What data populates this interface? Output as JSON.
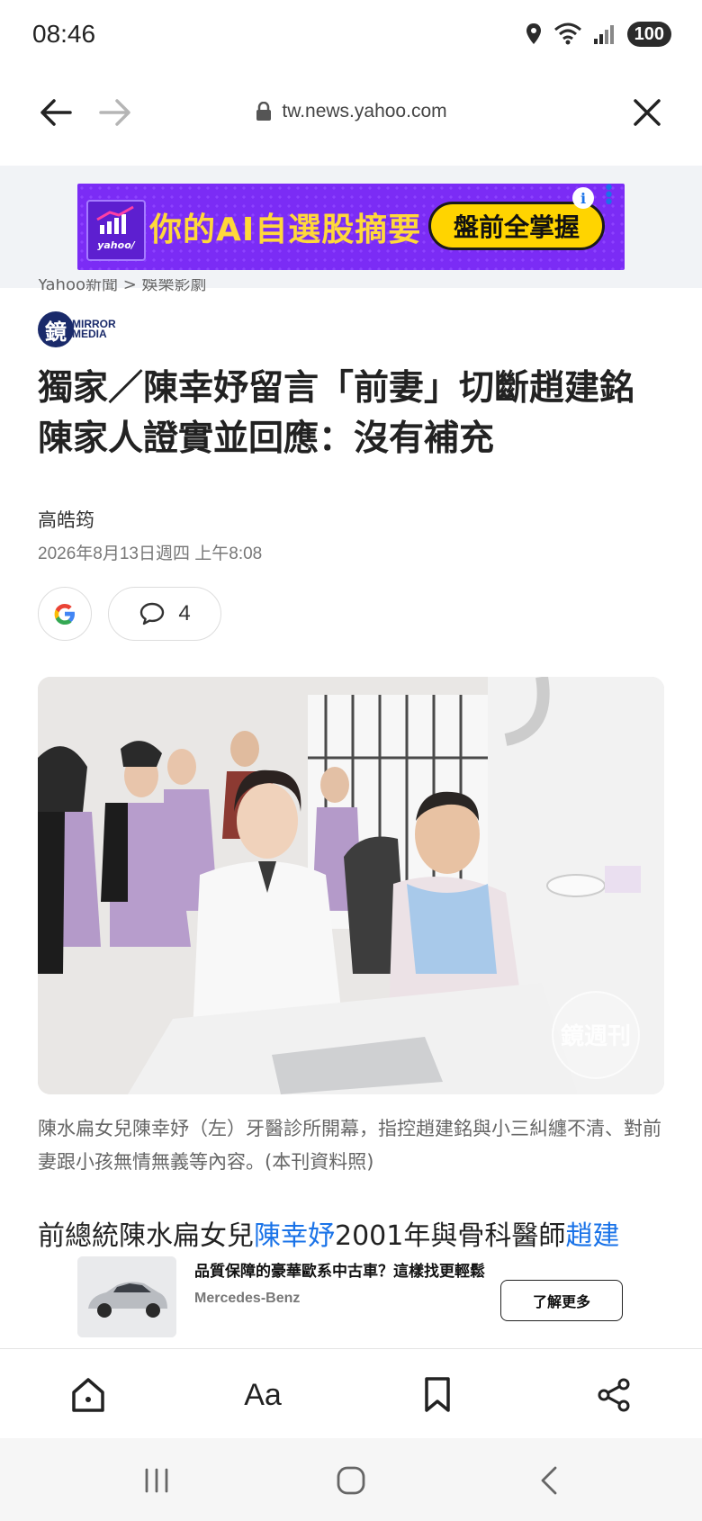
{
  "status_bar": {
    "time": "08:46",
    "battery": "100"
  },
  "browser": {
    "url": "tw.news.yahoo.com"
  },
  "ad_banner": {
    "logo_text": "yahoo/",
    "headline": "你的AI自選股摘要",
    "cta": "盤前全掌握",
    "info_icon": "i"
  },
  "article": {
    "breadcrumb": "Yahoo新聞 > 娛樂影劇",
    "publisher_glyph": "鏡",
    "publisher_name_1": "MIRROR",
    "publisher_name_2": "MEDIA",
    "headline": "獨家／陳幸妤留言「前妻」切斷趙建銘 陳家人證實並回應：沒有補充",
    "author": "高皓筠",
    "date": "2026年8月13日週四 上午8:08",
    "comment_count": "4",
    "photo_watermark": "鏡週刊",
    "caption": "陳水扁女兒陳幸妤（左）牙醫診所開幕，指控趙建銘與小三糾纏不清、對前妻跟小孩無情無義等內容。(本刊資料照)",
    "body_part1": "前總統陳水扁女兒",
    "body_link1": "陳幸妤",
    "body_part2": "2001年與骨科醫師",
    "body_link2": "趙建"
  },
  "sponsored": {
    "title": "品質保障的豪華歐系中古車？這樣找更輕鬆",
    "brand": "Mercedes-Benz",
    "cta": "了解更多"
  },
  "toolbar": {
    "font_size_label": "Aa"
  },
  "colors": {
    "link": "#1a73e8",
    "ad_bg": "#7b2cf5",
    "ad_text": "#ffd83a",
    "ad_cta": "#ffd400"
  }
}
